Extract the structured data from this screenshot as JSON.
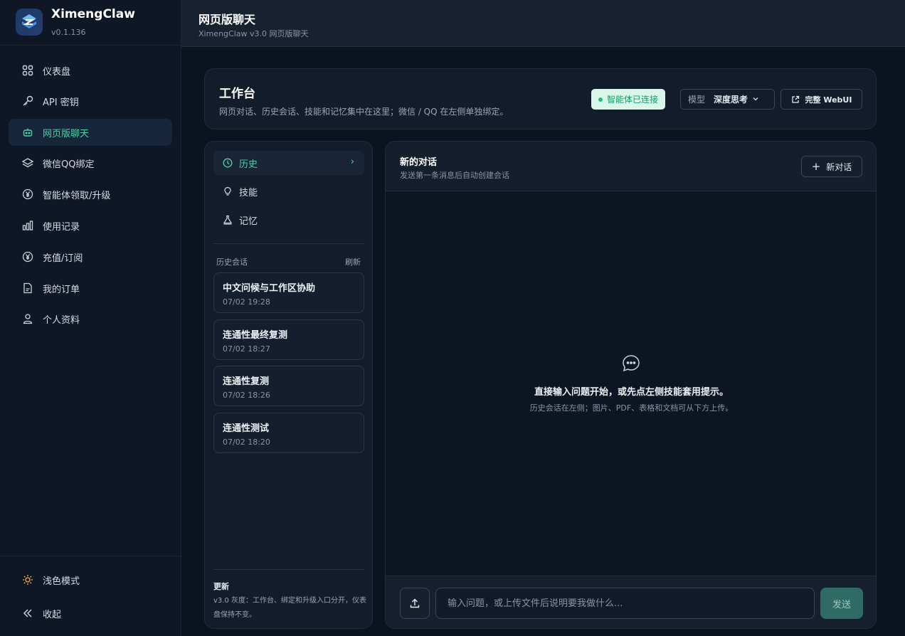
{
  "brand": {
    "name": "XimengClaw",
    "version": "v0.1.136"
  },
  "sidebar": {
    "items": [
      {
        "label": "仪表盘",
        "icon": "grid-icon"
      },
      {
        "label": "API 密钥",
        "icon": "key-icon"
      },
      {
        "label": "网页版聊天",
        "icon": "bot-icon",
        "active": true
      },
      {
        "label": "微信QQ绑定",
        "icon": "layers-icon"
      },
      {
        "label": "智能体领取/升级",
        "icon": "yen-icon"
      },
      {
        "label": "使用记录",
        "icon": "bar-chart-icon"
      },
      {
        "label": "充值/订阅",
        "icon": "yen-icon"
      },
      {
        "label": "我的订单",
        "icon": "document-icon"
      },
      {
        "label": "个人资料",
        "icon": "user-icon"
      }
    ],
    "theme_toggle": "浅色模式",
    "collapse": "收起"
  },
  "header": {
    "title": "网页版聊天",
    "subtitle": "XimengClaw v3.0 网页版聊天"
  },
  "workbench": {
    "title": "工作台",
    "description": "网页对话、历史会话、技能和记忆集中在这里；微信 / QQ 在左侧单独绑定。",
    "status": "智能体已连接",
    "model_label": "模型",
    "model_value": "深度思考",
    "webui_label": "完整 WebUI",
    "colors": {
      "status_bg": "#d9f6e9",
      "status_text": "#169b6b",
      "accent": "#4fd1a8"
    }
  },
  "left_panel": {
    "tabs": [
      {
        "label": "历史",
        "icon": "clock-icon",
        "active": true
      },
      {
        "label": "技能",
        "icon": "lightbulb-icon"
      },
      {
        "label": "记忆",
        "icon": "brain-icon"
      }
    ],
    "history_label": "历史会话",
    "refresh_label": "刷新",
    "sessions": [
      {
        "title": "中文问候与工作区协助",
        "time": "07/02 19:28"
      },
      {
        "title": "连通性最终复测",
        "time": "07/02 18:27"
      },
      {
        "title": "连通性复测",
        "time": "07/02 18:26"
      },
      {
        "title": "连通性测试",
        "time": "07/02 18:20"
      }
    ],
    "update_title": "更新",
    "update_text": "v3.0 灰度：工作台、绑定和升级入口分开，仪表盘保持不变。"
  },
  "chat": {
    "title": "新的对话",
    "subtitle": "发送第一条消息后自动创建会话",
    "new_chat_label": "新对话",
    "empty_main": "直接输入问题开始，或先点左侧技能套用提示。",
    "empty_sub": "历史会话在左侧；图片、PDF、表格和文档可从下方上传。",
    "input_placeholder": "输入问题，或上传文件后说明要我做什么...",
    "send_label": "发送"
  }
}
